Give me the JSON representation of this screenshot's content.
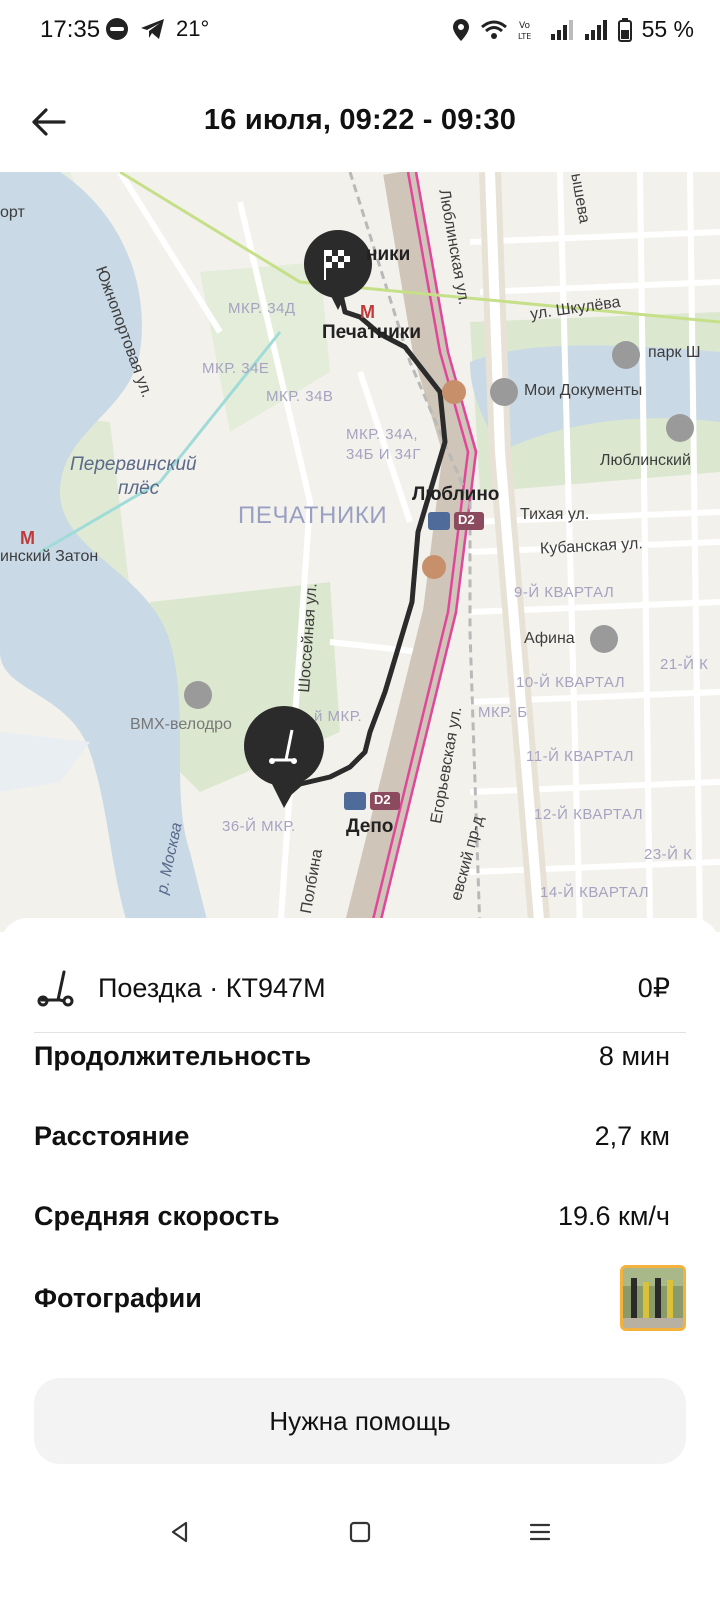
{
  "status_bar": {
    "time": "17:35",
    "temperature": "21°",
    "battery": "55 %",
    "icons": [
      "do-not-disturb-icon",
      "telegram-icon",
      "location-icon",
      "wifi-icon",
      "volte-icon",
      "signal-icon",
      "signal-icon",
      "battery-icon"
    ]
  },
  "header": {
    "title": "16 июля, 09:22 - 09:30"
  },
  "map": {
    "labels": {
      "port": "орт",
      "yuzhnoportovaya": "Южнопортовая ул.",
      "mkr34d": "МКР. 34Д",
      "mkr34e": "МКР. 34Е",
      "mkr34v": "МКР. 34В",
      "mkr34abg": "МКР. 34А,",
      "mkr34abg2": "34Б И 34Г",
      "pechatniki_station": "Печатники",
      "pechatniki_top": "ники",
      "lyublinskaya": "Люблинская ул.",
      "shkuleva": "ул. Шкулёва",
      "shkuleva_top": "ышева",
      "park": "парк Ш",
      "moi_dokumenty": "Мои Документы",
      "lyublinsky": "Люблинский",
      "perervinsky": "Перервинский",
      "ples": "плёс",
      "pechatniki_district": "ПЕЧАТНИКИ",
      "lyublino": "Люблино",
      "tikhaya": "Тихая ул.",
      "kubanskaya": "Кубанская ул.",
      "kvartal9": "9-Й КВАРТАЛ",
      "afina": "Афина",
      "kvartal10": "10-Й КВАРТАЛ",
      "kvartal21": "21-Й К",
      "zaton": "инский Затон",
      "shosseynaya": "Шоссейная ул.",
      "bmx": "ВМХ-велодро",
      "mkr_b": "МКР. Б",
      "kvartal11": "11-Й КВАРТАЛ",
      "egorevskaya": "Егорьевская ул.",
      "kvartal12": "12-Й КВАРТАЛ",
      "mkr36": "36-Й МКР.",
      "depo": "Депо",
      "moskva": "р. Москва",
      "kvartal23": "23-Й К",
      "kvartal14": "14-Й КВАРТАЛ",
      "polbina": "Полбина",
      "egorevsky_pr": "евский пр-д",
      "d2a": "D2",
      "d2b": "D2",
      "mkr_small": "й МКР."
    }
  },
  "trip": {
    "title": "Поездка · КТ947М",
    "price": "0₽"
  },
  "details": {
    "duration_label": "Продолжительность",
    "duration_value": "8 мин",
    "distance_label": "Расстояние",
    "distance_value": "2,7 км",
    "speed_label": "Средняя скорость",
    "speed_value": "19.6 км/ч",
    "photos_label": "Фотографии"
  },
  "help_button": {
    "label": "Нужна помощь"
  },
  "colors": {
    "route": "#2b2b2b",
    "water": "#c9d9e6",
    "park": "#dbe8cf",
    "rail_accent": "#e0479b",
    "photo_border": "#f2b23c"
  }
}
